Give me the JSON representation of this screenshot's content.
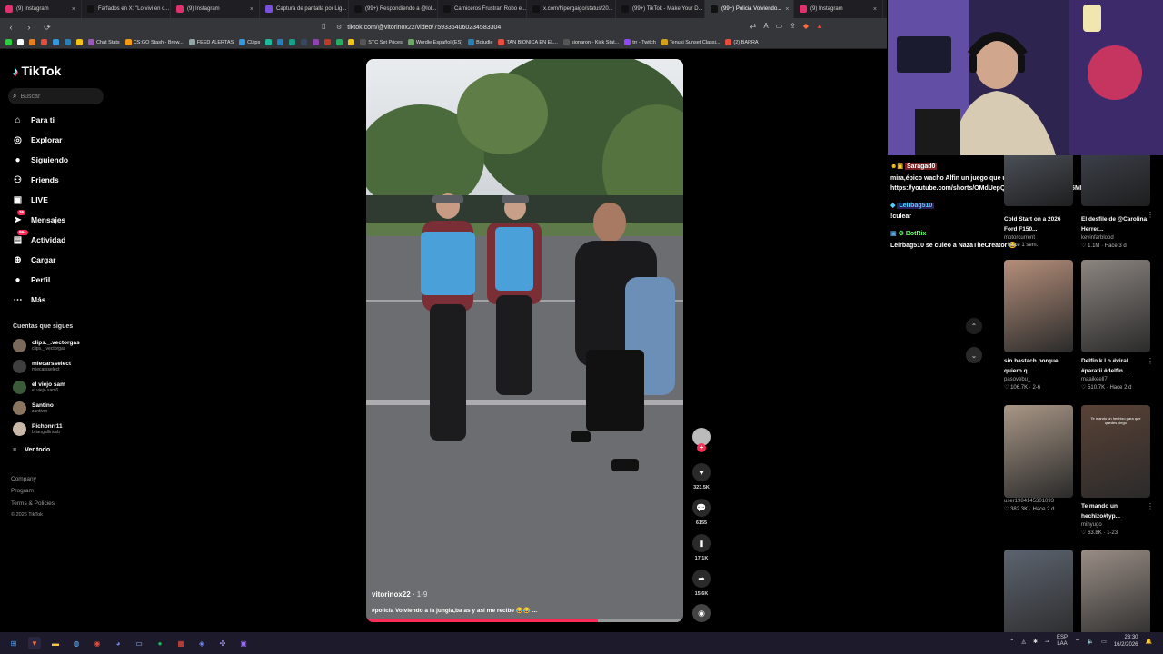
{
  "browser": {
    "tabs": [
      {
        "label": "(9) Instagram",
        "color": "#e1306c"
      },
      {
        "label": "Farfados en X: \"Lo vivi en c...",
        "color": "#111111"
      },
      {
        "label": "(9) Instagram",
        "color": "#e1306c"
      },
      {
        "label": "Captura de pantalla por Lig...",
        "color": "#7b4fe0"
      },
      {
        "label": "(99+) Respondiendo a @lol...",
        "color": "#111111"
      },
      {
        "label": "Carniceros Frustran Robo e...",
        "color": "#111111"
      },
      {
        "label": "x.com/hipergaigo/status/20...",
        "color": "#111111"
      },
      {
        "label": "(99+) TikTok - Make Your D...",
        "color": "#111111"
      },
      {
        "label": "(99+) Policia Volviendo...",
        "color": "#111111",
        "active": true
      },
      {
        "label": "(9) Instagram",
        "color": "#e1306c"
      }
    ],
    "url": "tiktok.com/@vitorinox22/video/7593364060234583304",
    "bookmarks": [
      {
        "label": "",
        "color": "#2ecc40"
      },
      {
        "label": "",
        "color": "#fff"
      },
      {
        "label": "",
        "color": "#e67e22"
      },
      {
        "label": "",
        "color": "#e74c3c"
      },
      {
        "label": "",
        "color": "#3498db"
      },
      {
        "label": "",
        "color": "#2980b9"
      },
      {
        "label": "",
        "color": "#f1c40f"
      },
      {
        "label": "Chat Stats",
        "color": "#9b59b6"
      },
      {
        "label": "CS:GO Stash - Brow...",
        "color": "#f39c12"
      },
      {
        "label": "FEED ALERTAS",
        "color": "#95a5a6"
      },
      {
        "label": "CLips",
        "color": "#3498db"
      },
      {
        "label": "",
        "color": "#1abc9c"
      },
      {
        "label": "",
        "color": "#2980b9"
      },
      {
        "label": "",
        "color": "#16a085"
      },
      {
        "label": "",
        "color": "#34495e"
      },
      {
        "label": "",
        "color": "#8e44ad"
      },
      {
        "label": "",
        "color": "#c0392b"
      },
      {
        "label": "",
        "color": "#27ae60"
      },
      {
        "label": "",
        "color": "#f1c40f"
      },
      {
        "label": "STC Set Prices",
        "color": "#555"
      },
      {
        "label": "Wordle Español (ES)",
        "color": "#6aaa64"
      },
      {
        "label": "Boiudle",
        "color": "#2980b9"
      },
      {
        "label": "TAN BIONICA EN EL...",
        "color": "#e74c3c"
      },
      {
        "label": "sionaron - Kick Stat...",
        "color": "#555"
      },
      {
        "label": "trr - Twitch",
        "color": "#9146ff"
      },
      {
        "label": "Tenuki Sunset Classi...",
        "color": "#d4a017"
      },
      {
        "label": "(2) BARRA",
        "color": "#e74c3c"
      }
    ]
  },
  "tiktok": {
    "logo": "TikTok",
    "search_placeholder": "Buscar",
    "menu": [
      {
        "label": "Para ti",
        "icon": "home-icon",
        "glyph": "⌂"
      },
      {
        "label": "Explorar",
        "icon": "compass-icon",
        "glyph": "◎"
      },
      {
        "label": "Siguiendo",
        "icon": "following-avatar-icon",
        "glyph": "●"
      },
      {
        "label": "Friends",
        "icon": "friends-icon",
        "glyph": "⚇"
      },
      {
        "label": "LIVE",
        "icon": "live-icon",
        "glyph": "▣"
      },
      {
        "label": "Mensajes",
        "icon": "messages-icon",
        "glyph": "➤",
        "badge": "36"
      },
      {
        "label": "Actividad",
        "icon": "activity-icon",
        "glyph": "▤",
        "badge": "99+"
      },
      {
        "label": "Cargar",
        "icon": "upload-icon",
        "glyph": "⊕"
      },
      {
        "label": "Perfil",
        "icon": "profile-avatar-icon",
        "glyph": "●"
      },
      {
        "label": "Más",
        "icon": "more-icon",
        "glyph": "⋯"
      }
    ],
    "follows_title": "Cuentas que sigues",
    "follows": [
      {
        "name": "clips._.vectorgas",
        "handle": "clips._.vectorgas"
      },
      {
        "name": "miecarsselect",
        "handle": "miecarsselect"
      },
      {
        "name": "el viejo sam",
        "handle": "el.viejo.sam6"
      },
      {
        "name": "Santino",
        "handle": "zantivm"
      },
      {
        "name": "Pichonrr11",
        "handle": "briangallinosb"
      }
    ],
    "see_all": "Ver todo",
    "footer": [
      "Company",
      "Program",
      "Terms & Policies",
      "© 2026 TikTok"
    ]
  },
  "video": {
    "author": "vitorinox22",
    "date": "1-9",
    "caption": "#policia Volviendo a la jungla,ba as y asi me recibe 😂😂 ...",
    "progress": 0.73,
    "likes": "323.5K",
    "comments": "6155",
    "saves": "17.1K",
    "shares": "15.6K"
  },
  "chat": {
    "messages": [
      {
        "user": "Saragad0",
        "user_color": "#ff4d4d",
        "text": "mira,épico wacho Alfin un juego que usa el control de play https://youtube.com/shorts/OMdUepQRYRs?si=tn7WfDKI3E5MFVb1"
      },
      {
        "user": "Leirbag510",
        "user_color": "#4dd0ff",
        "text": "!culear"
      },
      {
        "user": "BotRix",
        "user_color": "#6bff6b",
        "text": "Leirbag510 se culeo a NazaTheCreator 😂"
      }
    ]
  },
  "recommendations": [
    {
      "title": "Cold Start on a 2026 Ford F150...",
      "user": "motorcurrent",
      "likes": "",
      "age": "Hace 1 sem.",
      "tone": "#4a4f57"
    },
    {
      "title": "El desfile de @Carolina Herrer...",
      "user": "kevinfarblood",
      "likes": "1.1M",
      "age": "Hace 3 d",
      "tone": "#3b3f48"
    },
    {
      "title": "sin hastach porque quiero q...",
      "user": "pasovebu_",
      "likes": "106.7K",
      "age": "2-6",
      "tone": "#b58f7a"
    },
    {
      "title": "Delfín k l o #viral #paratii #delfin...",
      "user": "maaikeell7",
      "likes": "510.7K",
      "age": "Hace 2 d",
      "tone": "#8c8580"
    },
    {
      "title": "",
      "user": "user1984145301093",
      "likes": "382.3K",
      "age": "Hace 2 d",
      "tone": "#a99786"
    },
    {
      "title": "Te mando un hechizo#fyp...",
      "user": "mihyugo",
      "likes": "63.8K",
      "age": "1-23",
      "tone": "#5a4236",
      "overlay": "Te mando un hechizo para que quedes ciego"
    },
    {
      "title": "",
      "user": "",
      "likes": "",
      "age": "",
      "tone": "#5d6470"
    },
    {
      "title": "",
      "user": "",
      "likes": "",
      "age": "",
      "tone": "#9a8e86"
    }
  ],
  "taskbar": {
    "lang": "ESP\nLAA",
    "time": "23:30",
    "date": "16/2/2026"
  }
}
